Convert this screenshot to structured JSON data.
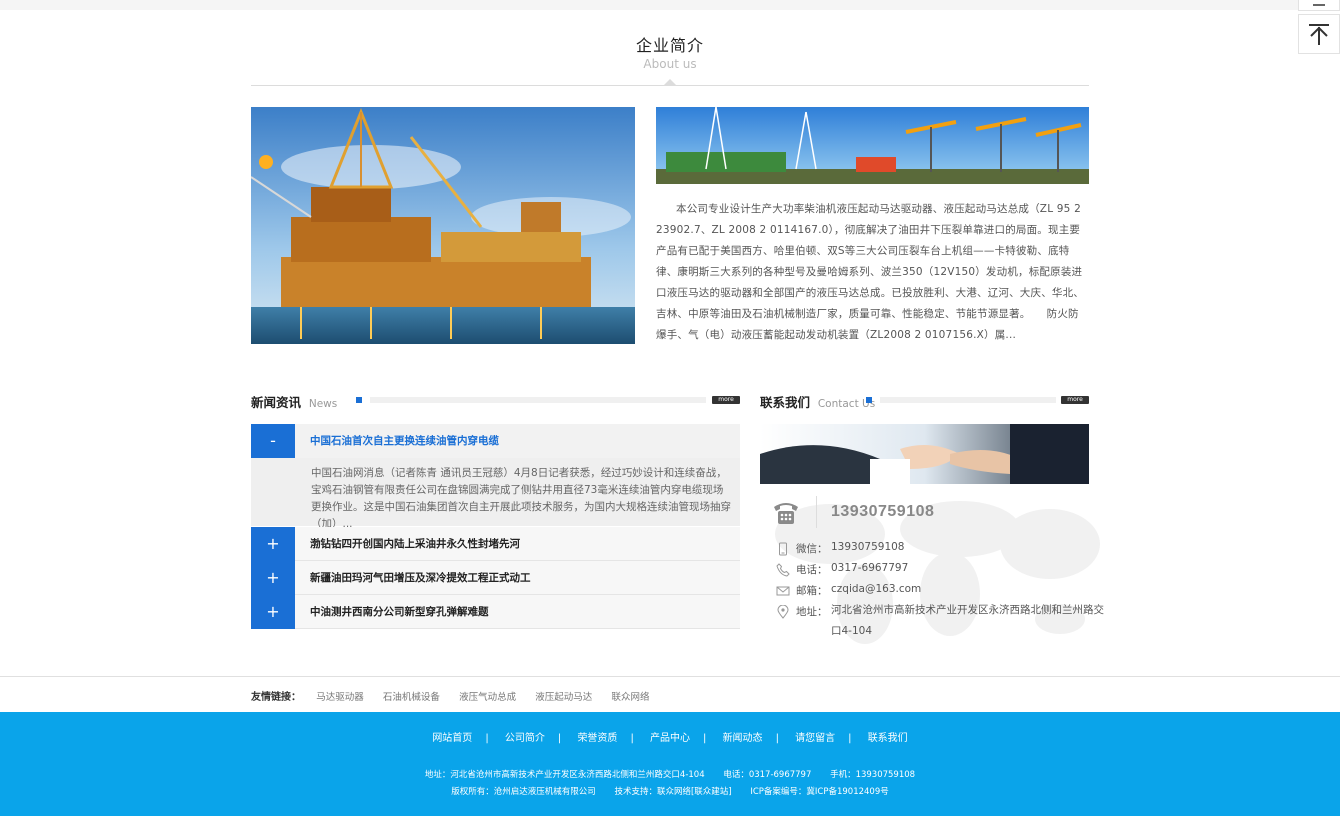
{
  "about": {
    "title": "企业简介",
    "subtitle": "About us",
    "text": "本公司专业设计生产大功率柴油机液压起动马达驱动器、液压起动马达总成（ZL 95 2 23902.7、ZL 2008 2 0114167.0），彻底解决了油田井下压裂单靠进口的局面。现主要产品有已配于美国西方、哈里伯顿、双S等三大公司压裂车台上机组——卡特彼勒、底特律、康明斯三大系列的各种型号及曼哈姆系列、波兰350（12V150）发动机，标配原装进口液压马达的驱动器和全部国产的液压马达总成。已投放胜利、大港、辽河、大庆、华北、吉林、中原等油田及石油机械制造厂家，质量可靠、性能稳定、节能节源显著。　　防火防爆手、气（电）动液压蓄能起动发动机装置（ZL2008 2 0107156.X）属..."
  },
  "news": {
    "title_cn": "新闻资讯",
    "title_en": "News",
    "more": "more",
    "open": {
      "toggle": "-",
      "title": "中国石油首次自主更换连续油管内穿电缆",
      "summary": "中国石油网消息（记者陈青 通讯员王冠慈）4月8日记者获悉，经过巧妙设计和连续奋战，宝鸡石油钢管有限责任公司在盘锦圆满完成了侧钻井用直径73毫米连续油管内穿电缆现场更换作业。这是中国石油集团首次自主开展此项技术服务，为国内大规格连续油管现场抽穿（加）..."
    },
    "items": [
      {
        "toggle": "+",
        "title": "渤钻钻四开创国内陆上采油井永久性封堵先河"
      },
      {
        "toggle": "+",
        "title": "新疆油田玛河气田增压及深冷提效工程正式动工"
      },
      {
        "toggle": "+",
        "title": "中油测井西南分公司新型穿孔弹解难题"
      }
    ]
  },
  "contact": {
    "title_cn": "联系我们",
    "title_en": "Contact Us",
    "more": "more",
    "hotline": "13930759108",
    "rows": [
      {
        "icon": "phone-mobile-icon",
        "label": "微信：",
        "value": "13930759108"
      },
      {
        "icon": "telephone-icon",
        "label": "电话：",
        "value": "0317-6967797"
      },
      {
        "icon": "mail-icon",
        "label": "邮箱：",
        "value": "czqida@163.com"
      },
      {
        "icon": "location-icon",
        "label": "地址：",
        "value": "河北省沧州市高新技术产业开发区永济西路北侧和兰州路交口4-104"
      }
    ]
  },
  "links": {
    "title": "友情链接：",
    "items": [
      "马达驱动器",
      "石油机械设备",
      "液压气动总成",
      "液压起动马达",
      "联众网络"
    ]
  },
  "footer": {
    "nav": [
      "网站首页",
      "公司简介",
      "荣誉资质",
      "产品中心",
      "新闻动态",
      "请您留言",
      "联系我们"
    ],
    "separator": "|",
    "address": "地址：河北省沧州市高新技术产业开发区永济西路北侧和兰州路交口4-104",
    "phone": "电话：0317-6967797",
    "mobile": "手机：13930759108",
    "copyright": "版权所有：沧州启达液压机械有限公司",
    "support": "技术支持：联众网络[联众建站]",
    "icp": "ICP备案编号：冀ICP备19012409号"
  },
  "colors": {
    "accent": "#1a6fd5",
    "footer": "#0aa4ea"
  }
}
